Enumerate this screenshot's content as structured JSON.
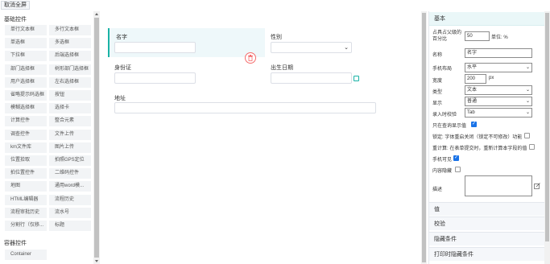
{
  "top_tab": "取消全屏",
  "palette": {
    "basic_title": "基础控件",
    "basic_items": [
      "单行文本框",
      "多行文本框",
      "单选框",
      "多选框",
      "下拉框",
      "后端选择框",
      "部门选择框",
      "树形部门选择框",
      "用户选择框",
      "左右选择框",
      "省略提示码选框",
      "按钮",
      "模糊选择框",
      "选择卡",
      "计算控件",
      "整合元素",
      "调查控件",
      "文件上传",
      "km文件库",
      "图片上传",
      "位置拾取",
      "拍照GPS定位",
      "拍位置控件",
      "二维码控件",
      "地图",
      "通用word模...",
      "HTML编辑器",
      "流程历史",
      "流程审批历史",
      "流水号",
      "分割行（仅移...",
      "标题"
    ],
    "container_title": "容器控件",
    "container_items": [
      "Container"
    ]
  },
  "canvas": {
    "fields": {
      "name_label": "名字",
      "gender_label": "性别",
      "id_label": "身份证",
      "birth_label": "出生日期",
      "address_label": "地址"
    }
  },
  "props": {
    "header": "基本",
    "width_pct_label_1": "占具占父级的",
    "width_pct_label_2": "百分比",
    "width_pct_value": "50",
    "width_pct_unit": "单位: %",
    "name_label": "名称",
    "name_value": "名字",
    "mobile_layout_label": "手机布局",
    "mobile_layout_value": "水平",
    "width_label": "宽度",
    "width_value": "200",
    "width_unit": "px",
    "type_label": "类型",
    "type_value": "文本",
    "display_label": "显示",
    "display_value": "普通",
    "input_rule_label": "录入时校验",
    "input_rule_value": "Tab",
    "show_query_label": "只在查询显示值",
    "lock_label": "锁定: 字体重启关闭（锁定不可修改）功能",
    "recalc_label": "重计算: 在表单提交时，重新计算本字段的值",
    "mobile_visible_label": "手机可见",
    "hidden_label": "内容隐藏",
    "desc_label": "描述",
    "sections": [
      "值",
      "校验",
      "隐藏条件",
      "打印时隐藏条件"
    ]
  }
}
